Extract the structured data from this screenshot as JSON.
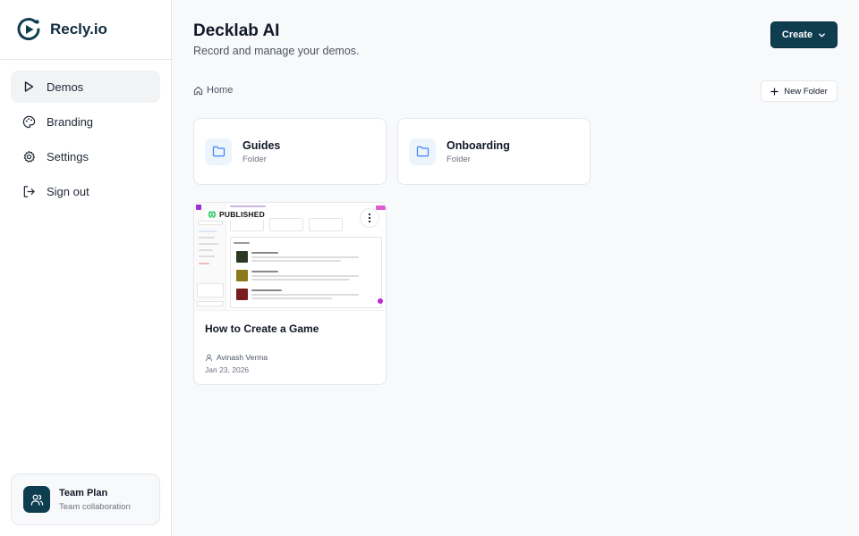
{
  "brand": {
    "name": "Recly.io"
  },
  "sidebar": {
    "items": [
      {
        "label": "Demos",
        "icon": "play-icon",
        "active": true
      },
      {
        "label": "Branding",
        "icon": "palette-icon",
        "active": false
      },
      {
        "label": "Settings",
        "icon": "gear-icon",
        "active": false
      },
      {
        "label": "Sign out",
        "icon": "sign-out-icon",
        "active": false
      }
    ],
    "plan": {
      "title": "Team Plan",
      "subtitle": "Team collaboration",
      "icon": "users-icon"
    }
  },
  "header": {
    "title": "Decklab AI",
    "subtitle": "Record and manage your demos.",
    "create_label": "Create"
  },
  "breadcrumb": {
    "home_label": "Home"
  },
  "toolbar": {
    "new_folder_label": "New Folder"
  },
  "folders": [
    {
      "name": "Guides",
      "type": "Folder"
    },
    {
      "name": "Onboarding",
      "type": "Folder"
    }
  ],
  "demos": [
    {
      "title": "How to Create a Game",
      "status": "PUBLISHED",
      "author": "Avinash Verma",
      "date": "Jan 23, 2026"
    }
  ],
  "colors": {
    "accent": "#0f3d50",
    "folder_icon": "#3b82f6",
    "published": "#22c55e"
  }
}
